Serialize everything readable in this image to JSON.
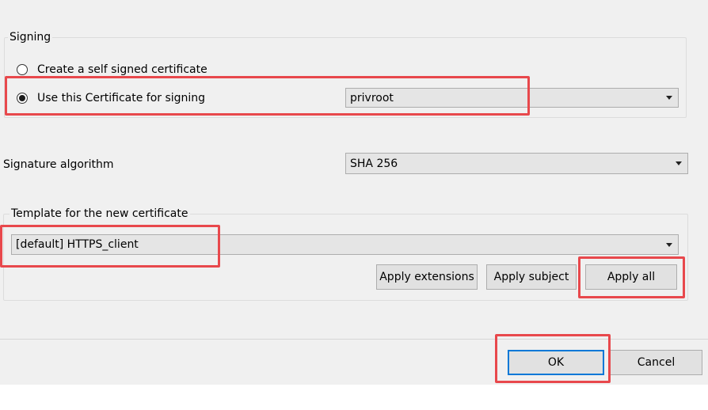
{
  "signing": {
    "title": "Signing",
    "option_self_signed": "Create a self signed certificate",
    "option_use_cert": "Use this Certificate for signing",
    "selected_option": "use_cert",
    "certificate_value": "privroot"
  },
  "signature": {
    "label": "Signature algorithm",
    "value": "SHA 256"
  },
  "template": {
    "title": "Template for the new certificate",
    "value": "[default] HTTPS_client",
    "apply_extensions": "Apply extensions",
    "apply_subject": "Apply subject",
    "apply_all": "Apply all"
  },
  "footer": {
    "ok": "OK",
    "cancel": "Cancel"
  },
  "colors": {
    "highlight": "#e8484c",
    "default_button_border": "#0078d7"
  }
}
